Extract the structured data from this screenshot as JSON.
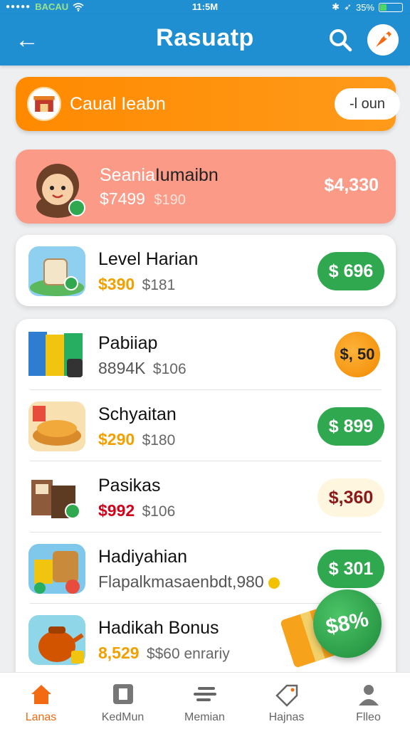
{
  "status_bar": {
    "carrier": "BACAU",
    "time": "11:5M",
    "battery": "35%"
  },
  "header": {
    "title": "Rasuatp"
  },
  "banner": {
    "label": "Caual Ieabn",
    "button": "-l oun"
  },
  "featured": {
    "title_a": "Seania",
    "title_b": "Iumaibn",
    "price": "$7499",
    "old_price": "$190",
    "right_value": "$4,330"
  },
  "items": [
    {
      "title": "Level Harian",
      "price": "$390",
      "old_price": "$181",
      "badge": "$ 696",
      "badge_color": "#2fa84f"
    },
    {
      "title": "Pabiiap",
      "price": "8894K",
      "old_price": "$106",
      "badge": "$, 50",
      "badge_color": "#f7a21b"
    },
    {
      "title": "Schyaitan",
      "price": "$290",
      "old_price": "$180",
      "badge": "$ 899",
      "badge_color": "#2fa84f"
    },
    {
      "title": "Pasikas",
      "price": "$992",
      "old_price": "$106",
      "badge": "$,360",
      "badge_color": "#fff6df"
    },
    {
      "title": "Hadiyahian",
      "price": "Flapalkmasaenbdt,980",
      "old_price": "",
      "badge": "$ 301",
      "badge_color": "#2fa84f"
    },
    {
      "title": "Hadikah Bonus",
      "price": "8,529",
      "old_price": "$$60 enrariy",
      "badge": "",
      "badge_color": ""
    }
  ],
  "fab": {
    "label": "$8%"
  },
  "bottom_nav": [
    {
      "label": "Lanas",
      "icon": "home-icon",
      "active": true
    },
    {
      "label": "KedMun",
      "icon": "box-icon",
      "active": false
    },
    {
      "label": "Memian",
      "icon": "menu-lines-icon",
      "active": false
    },
    {
      "label": "Hajnas",
      "icon": "tag-icon",
      "active": false
    },
    {
      "label": "Flleo",
      "icon": "profile-icon",
      "active": false
    }
  ],
  "colors": {
    "primary": "#1f8fd2",
    "accent": "#ff8a00",
    "featured": "#fb9a86",
    "green": "#2fa84f",
    "active_nav": "#f26b12"
  }
}
